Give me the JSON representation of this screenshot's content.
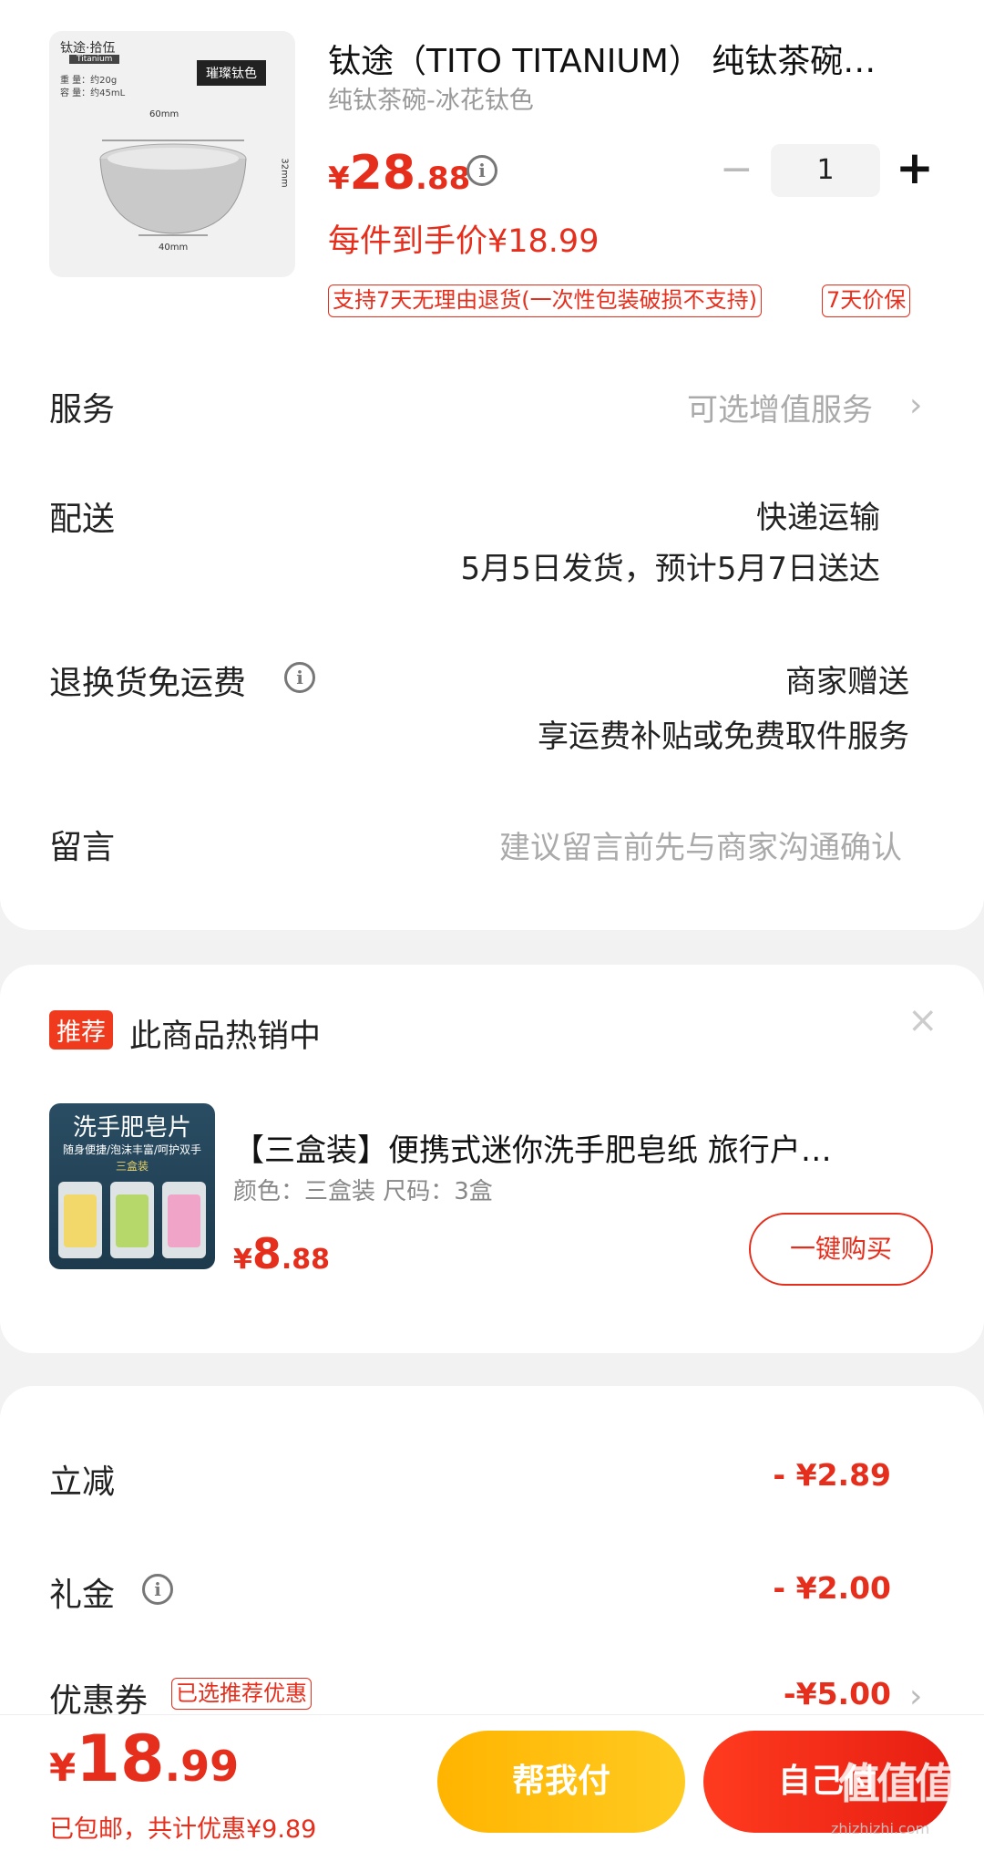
{
  "product": {
    "title": "钛途（TITO TITANIUM） 纯钛茶碗…",
    "subtitle": "纯钛茶碗-冰花钛色",
    "thumb": {
      "brand": "钛途·拾伍",
      "brand_sub": "Titanium",
      "spec_weight": "重 量：约20g",
      "spec_volume": "容 量：约45mL",
      "tag": "璀璨钛色",
      "dim_top": "60mm",
      "dim_bottom": "40mm",
      "dim_side": "32mm"
    },
    "price_currency": "¥",
    "price_int": "28",
    "price_dec": ".88",
    "final_price": "每件到手价¥18.99",
    "quantity": "1",
    "badges": [
      "支持7天无理由退货(一次性包装破损不支持)",
      "7天价保"
    ]
  },
  "rows": {
    "service_label": "服务",
    "service_value": "可选增值服务",
    "delivery_label": "配送",
    "delivery_method": "快递运输",
    "delivery_time": "5月5日发货，预计5月7日送达",
    "return_label": "退换货免运费",
    "return_value1": "商家赠送",
    "return_value2": "享运费补贴或免费取件服务",
    "message_label": "留言",
    "message_placeholder": "建议留言前先与商家沟通确认"
  },
  "recommend": {
    "badge": "推荐",
    "title": "此商品热销中",
    "close": "×",
    "thumb_heading": "洗手肥皂片",
    "thumb_sub": "随身便捷/泡沫丰富/呵护双手",
    "thumb_sub2": "三盒装",
    "name": "【三盒装】便携式迷你洗手肥皂纸 旅行户…",
    "spec": "颜色：三盒装   尺码：3盒",
    "price_currency": "¥",
    "price_int": "8",
    "price_dec": ".88",
    "buy": "一键购买"
  },
  "discounts": {
    "lijian_label": "立减",
    "lijian_value": "- ¥2.89",
    "lijin_label": "礼金",
    "lijin_value": "- ¥2.00",
    "coupon_label": "优惠券",
    "coupon_tag": "已选推荐优惠",
    "coupon_value": "-¥5.00"
  },
  "bottom": {
    "total_currency": "¥",
    "total_int": "18",
    "total_dec": ".99",
    "note": "已包邮，共计优惠¥9.89",
    "help_button": "帮我付",
    "self_button": "自己付",
    "watermark": "值值值",
    "watermark_url": "zhizhizhi.com"
  },
  "colors": {
    "accent": "#e62e1c",
    "help_button": "#ffb400",
    "muted_text": "#aaaaaa"
  },
  "icons": [
    "info-icon",
    "chevron-right-icon",
    "close-icon",
    "minus-icon",
    "plus-icon"
  ]
}
